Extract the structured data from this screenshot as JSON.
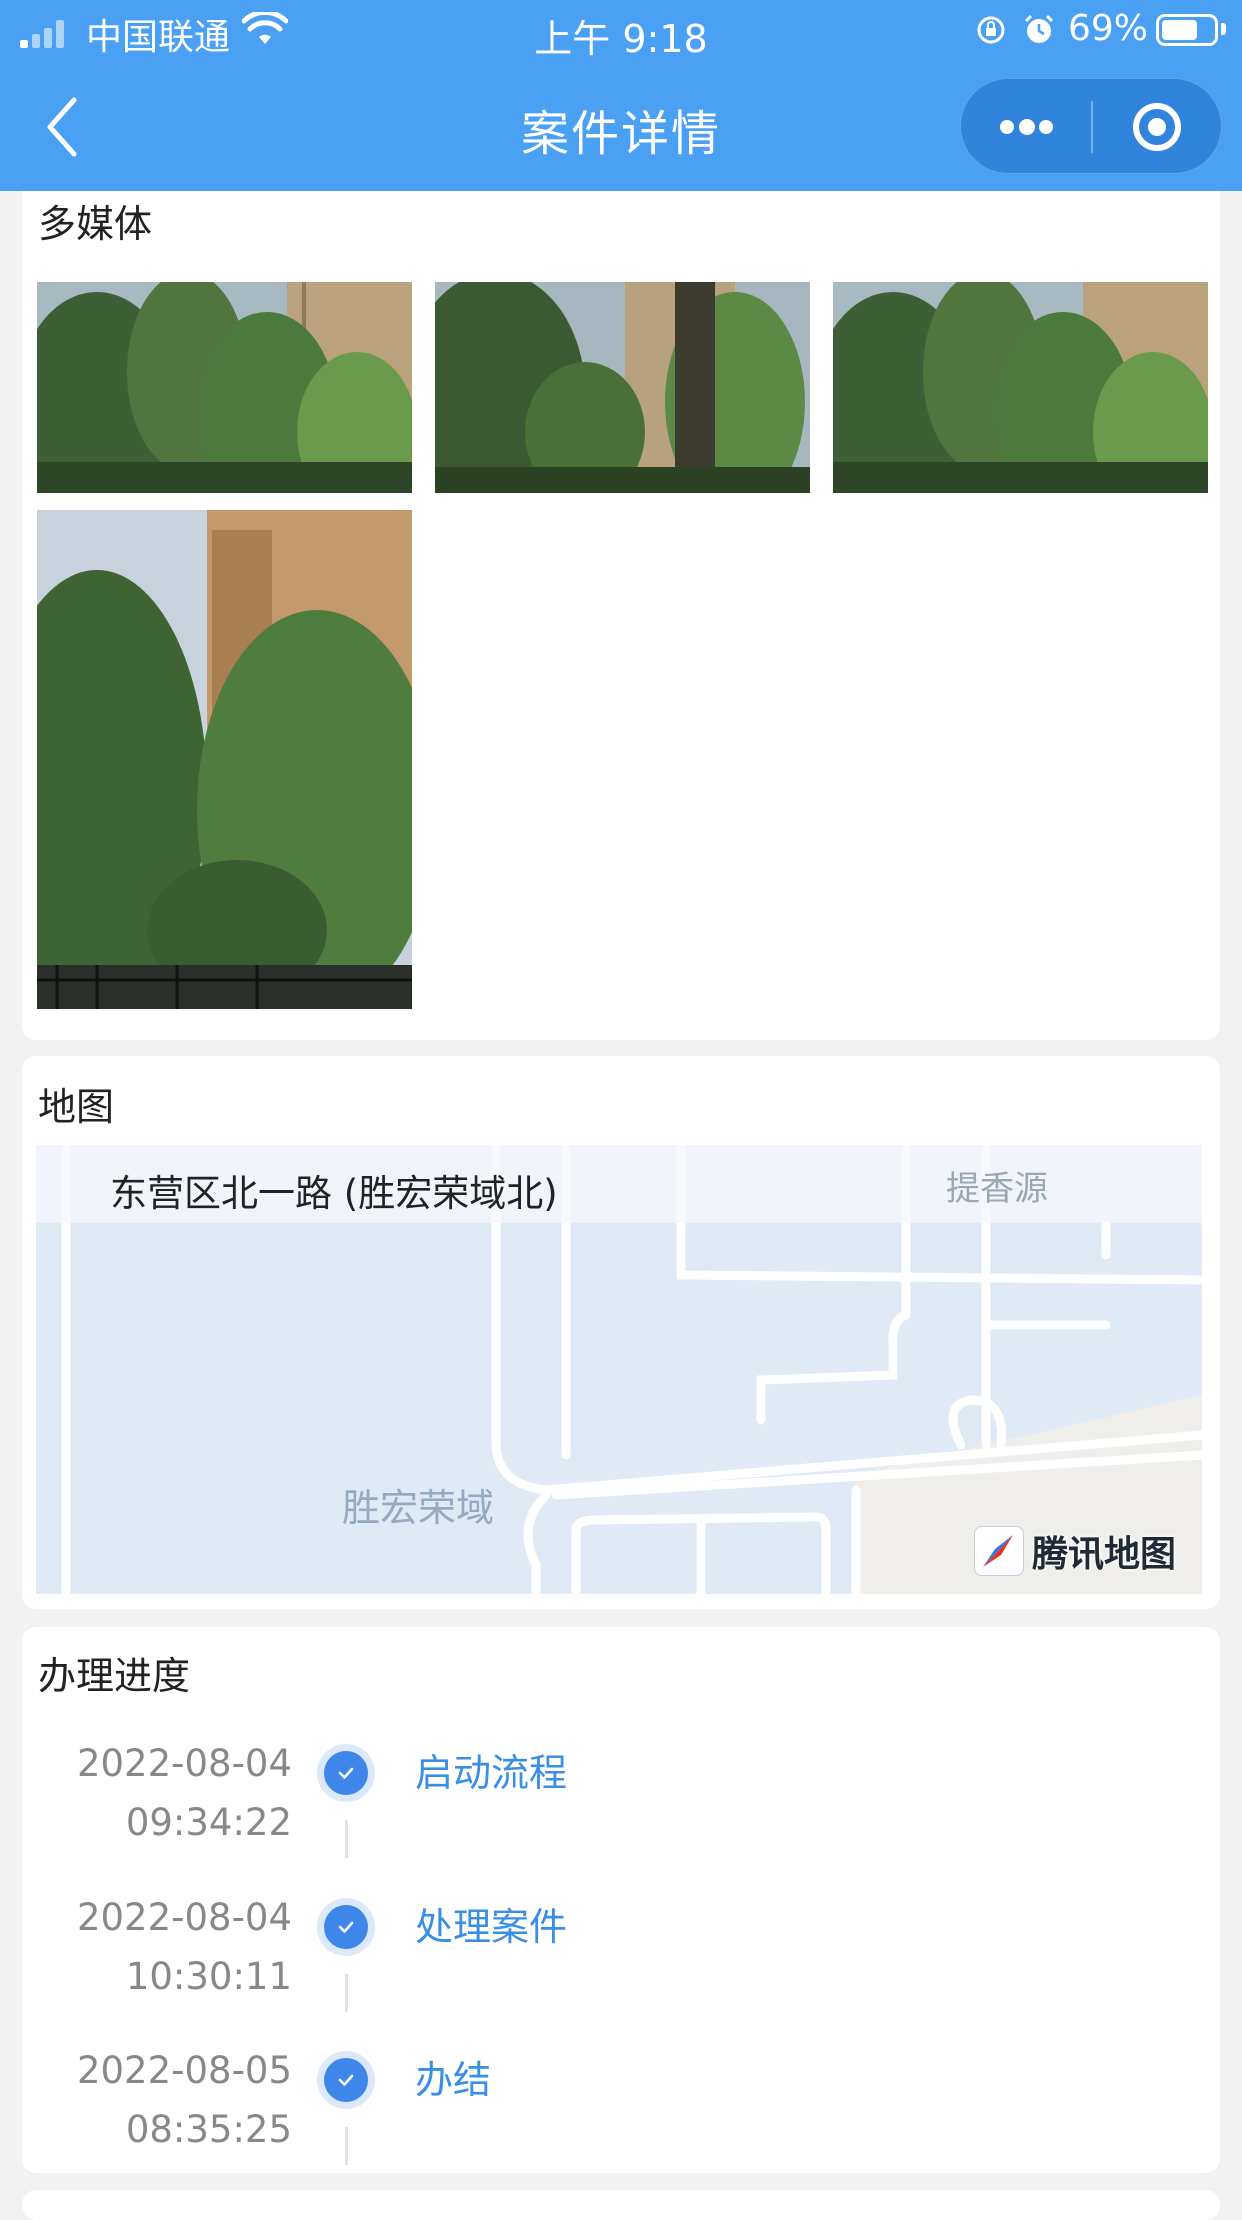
{
  "status_bar": {
    "carrier": "中国联通",
    "time": "上午 9:18",
    "battery_percent": "69%",
    "battery_level": 0.69,
    "icons": [
      "signal-icon",
      "wifi-icon",
      "rotation-lock-icon",
      "alarm-icon",
      "battery-icon"
    ]
  },
  "nav": {
    "title": "案件详情",
    "back_icon": "chevron-left-icon",
    "more_icon": "more-dots-icon",
    "close_icon": "target-circle-icon"
  },
  "media": {
    "title": "多媒体",
    "photos": [
      {
        "alt": "trees-photo-1"
      },
      {
        "alt": "trees-photo-2"
      },
      {
        "alt": "trees-photo-3"
      },
      {
        "alt": "building-trees-photo-4"
      }
    ]
  },
  "map": {
    "title": "地图",
    "address": "东营区北一路 (胜宏荣域北)",
    "pois": [
      "提香源",
      "胜宏荣域"
    ],
    "logo_text": "腾讯地图"
  },
  "progress": {
    "title": "办理进度",
    "steps": [
      {
        "date": "2022-08-04",
        "time": "09:34:22",
        "label": "启动流程"
      },
      {
        "date": "2022-08-04",
        "time": "10:30:11",
        "label": "处理案件"
      },
      {
        "date": "2022-08-05",
        "time": "08:35:25",
        "label": "办结"
      }
    ]
  },
  "colors": {
    "header_bg": "#4aa0f2",
    "link": "#3a8ee6",
    "check_dot": "#3f86ea",
    "page_bg": "#f2f2f2"
  }
}
